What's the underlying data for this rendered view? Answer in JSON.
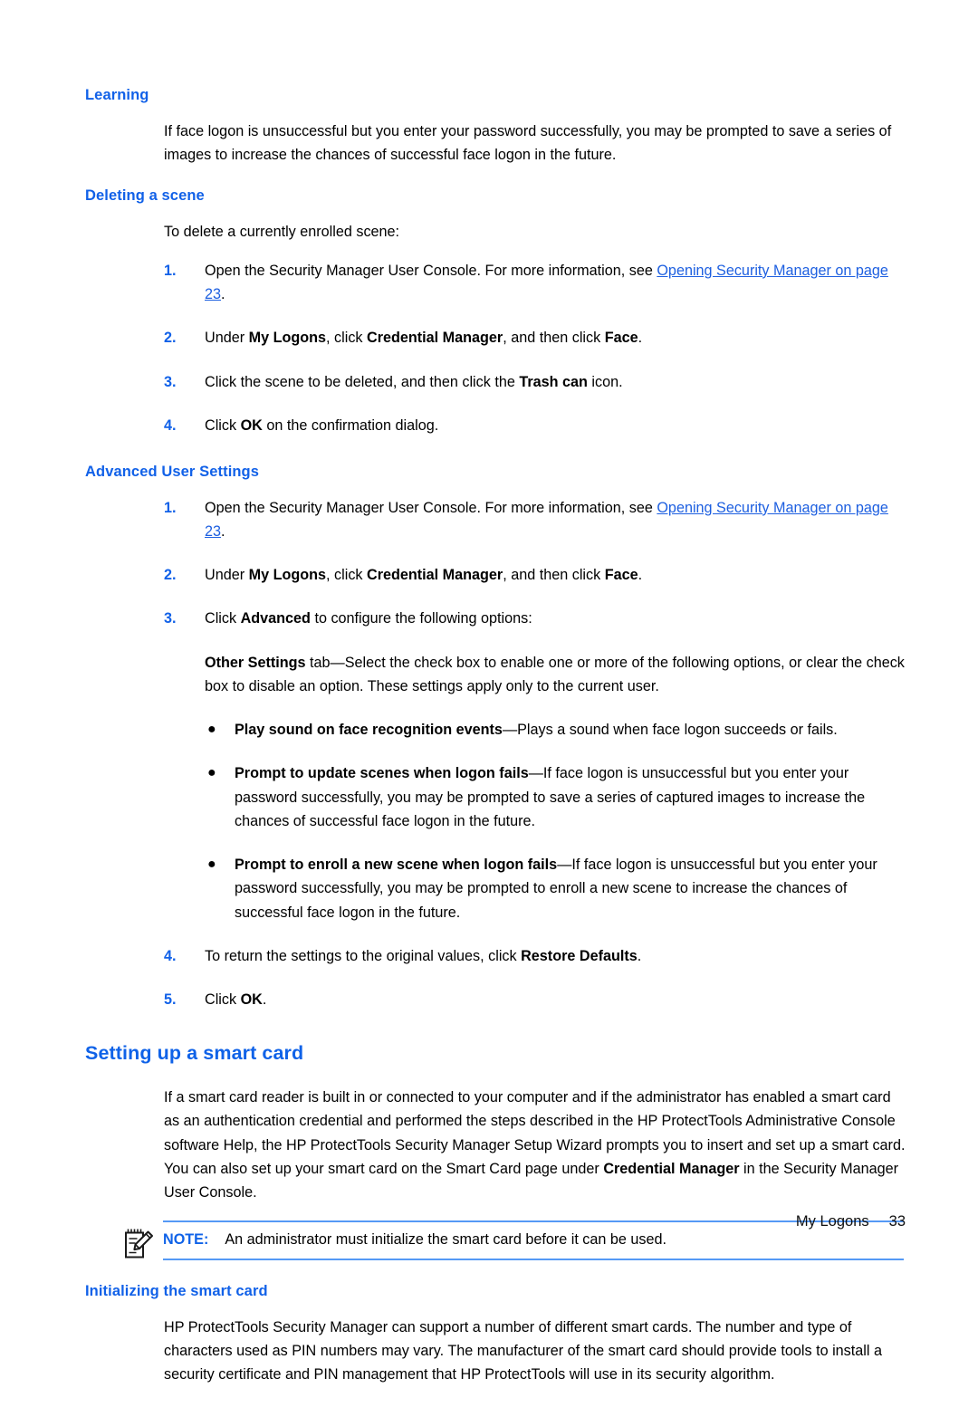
{
  "page": {
    "footer_section": "My Logons",
    "footer_page_number": "33",
    "heading_color": "#1161e8",
    "link_color": "#1d5fe0",
    "rule_color": "#5599f5"
  },
  "sections": {
    "learning": {
      "heading": "Learning",
      "paragraph": "If face logon is unsuccessful but you enter your password successfully, you may be prompted to save a series of images to increase the chances of successful face logon in the future."
    },
    "deleting_a_scene": {
      "heading": "Deleting a scene",
      "lead": "To delete a currently enrolled scene:",
      "steps": [
        {
          "num": "1.",
          "text_before": "Open the Security Manager User Console. For more information, see ",
          "link": "Opening Security Manager on page 23",
          "text_after": "."
        },
        {
          "num": "2.",
          "p1": "Under ",
          "b1": "My Logons",
          "p2": ", click ",
          "b2": "Credential Manager",
          "p3": ", and then click ",
          "b3": "Face",
          "p4": "."
        },
        {
          "num": "3.",
          "p1": "Click the scene to be deleted, and then click the ",
          "b1": "Trash can",
          "p2": " icon."
        },
        {
          "num": "4.",
          "p1": "Click ",
          "b1": "OK",
          "p2": " on the confirmation dialog."
        }
      ]
    },
    "advanced_user_settings": {
      "heading": "Advanced User Settings",
      "steps": [
        {
          "num": "1.",
          "text_before": "Open the Security Manager User Console. For more information, see ",
          "link": "Opening Security Manager on page 23",
          "text_after": "."
        },
        {
          "num": "2.",
          "p1": "Under ",
          "b1": "My Logons",
          "p2": ", click ",
          "b2": "Credential Manager",
          "p3": ", and then click ",
          "b3": "Face",
          "p4": "."
        },
        {
          "num": "3.",
          "p1": "Click ",
          "b1": "Advanced",
          "p2": " to configure the following options:",
          "other_settings": {
            "bold": "Other Settings",
            "text": " tab—Select the check box to enable one or more of the following options, or clear the check box to disable an option. These settings apply only to the current user."
          },
          "options": [
            {
              "bold": "Play sound on face recognition events",
              "text": "—Plays a sound when face logon succeeds or fails."
            },
            {
              "bold": "Prompt to update scenes when logon fails",
              "text": "—If face logon is unsuccessful but you enter your password successfully, you may be prompted to save a series of captured images to increase the chances of successful face logon in the future."
            },
            {
              "bold": "Prompt to enroll a new scene when logon fails",
              "text": "—If face logon is unsuccessful but you enter your password successfully, you may be prompted to enroll a new scene to increase the chances of successful face logon in the future."
            }
          ]
        },
        {
          "num": "4.",
          "p1": "To return the settings to the original values, click ",
          "b1": "Restore Defaults",
          "p2": "."
        },
        {
          "num": "5.",
          "p1": "Click ",
          "b1": "OK",
          "p2": "."
        }
      ]
    },
    "setting_up_a_smart_card": {
      "heading": "Setting up a smart card",
      "p1": "If a smart card reader is built in or connected to your computer and if the administrator has enabled a smart card as an authentication credential and performed the steps described in the HP ProtectTools Administrative Console software Help, the HP ProtectTools Security Manager Setup Wizard prompts you to insert and set up a smart card. You can also set up your smart card on the Smart Card page under ",
      "b1": "Credential Manager",
      "p2": " in the Security Manager User Console.",
      "note": {
        "icon": "note-pad-pencil-icon",
        "label": "NOTE:",
        "text": "An administrator must initialize the smart card before it can be used."
      }
    },
    "initializing_the_smart_card": {
      "heading": "Initializing the smart card",
      "paragraph": "HP ProtectTools Security Manager can support a number of different smart cards. The number and type of characters used as PIN numbers may vary. The manufacturer of the smart card should provide tools to install a security certificate and PIN management that HP ProtectTools will use in its security algorithm."
    }
  }
}
